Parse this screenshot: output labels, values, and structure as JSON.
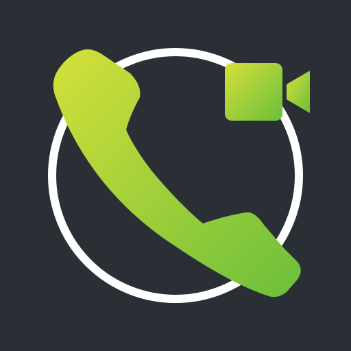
{
  "icon": {
    "kind": "app-icon",
    "depicts": [
      "phone-handset-icon",
      "video-camera-icon",
      "ring-outline"
    ],
    "colors": {
      "background": "#2a2f35",
      "ring": "#ffffff",
      "accent_light": "#d5e03a",
      "accent_dark": "#6bbf3b"
    }
  }
}
